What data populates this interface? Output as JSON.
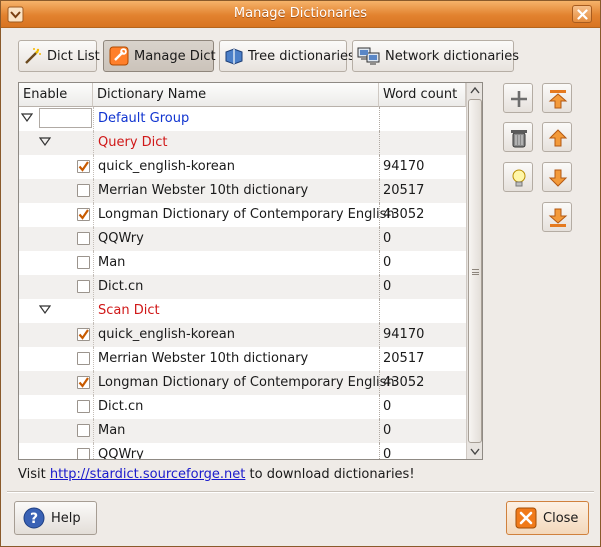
{
  "window": {
    "title": "Manage Dictionaries"
  },
  "toolbar": {
    "dict_list": "Dict List",
    "manage_dict": "Manage Dict",
    "tree_dictionaries": "Tree dictionaries",
    "network_dictionaries": "Network dictionaries"
  },
  "columns": {
    "enable": "Enable",
    "name": "Dictionary Name",
    "count": "Word count"
  },
  "tree": {
    "group": "Default Group",
    "query_label": "Query Dict",
    "scan_label": "Scan Dict",
    "query": [
      {
        "name": "quick_english-korean",
        "count": "94170",
        "enabled": true
      },
      {
        "name": "Merrian Webster 10th dictionary",
        "count": "20517",
        "enabled": false
      },
      {
        "name": "Longman Dictionary of Contemporary English",
        "count": "43052",
        "enabled": true
      },
      {
        "name": "QQWry",
        "count": "0",
        "enabled": false
      },
      {
        "name": "Man",
        "count": "0",
        "enabled": false
      },
      {
        "name": "Dict.cn",
        "count": "0",
        "enabled": false
      }
    ],
    "scan": [
      {
        "name": "quick_english-korean",
        "count": "94170",
        "enabled": true
      },
      {
        "name": "Merrian Webster 10th dictionary",
        "count": "20517",
        "enabled": false
      },
      {
        "name": "Longman Dictionary of Contemporary English",
        "count": "43052",
        "enabled": true
      },
      {
        "name": "Dict.cn",
        "count": "0",
        "enabled": false
      },
      {
        "name": "Man",
        "count": "0",
        "enabled": false
      },
      {
        "name": "QQWry",
        "count": "0",
        "enabled": false
      }
    ]
  },
  "footer": {
    "visit_prefix": "Visit ",
    "link": "http://stardict.sourceforge.net",
    "visit_suffix": " to download dictionaries!"
  },
  "buttons": {
    "help": "Help",
    "close": "Close"
  },
  "colors": {
    "titlebar": "#e2822f",
    "group": "#1034d0",
    "subgroup": "#d01818",
    "accent": "#e07c2a"
  }
}
